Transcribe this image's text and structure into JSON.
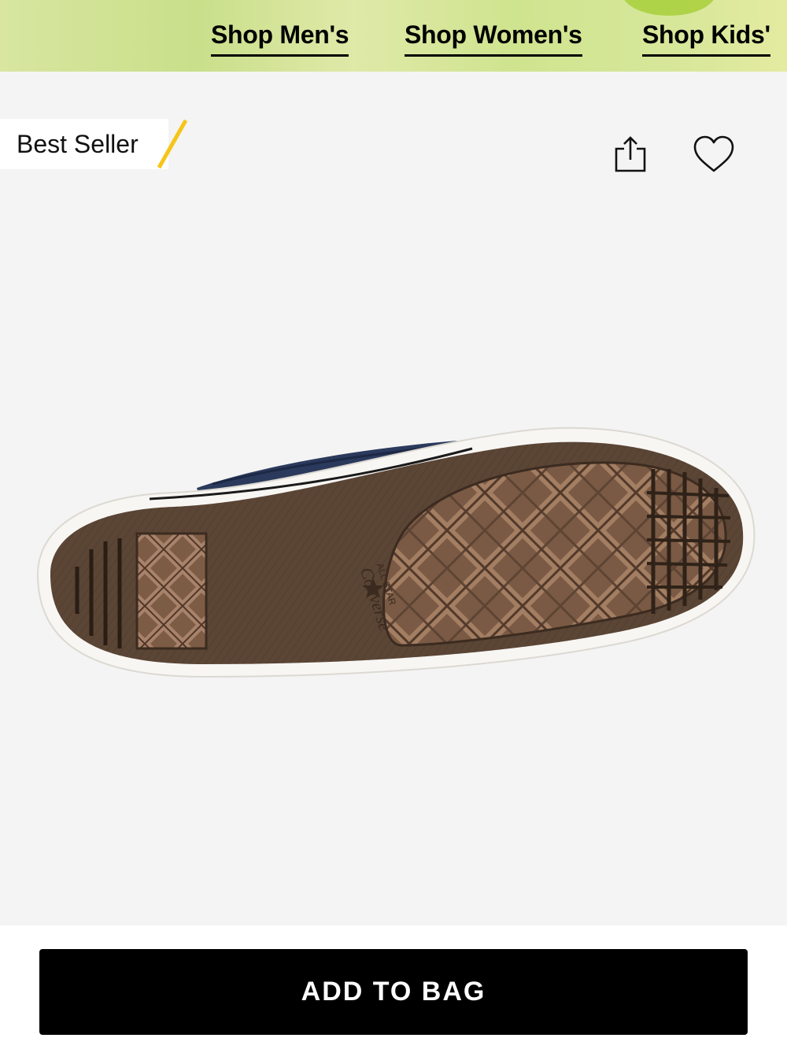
{
  "nav": {
    "links": [
      {
        "label": "Shop Men's"
      },
      {
        "label": "Shop Women's"
      },
      {
        "label": "Shop Kids'"
      }
    ]
  },
  "product": {
    "badge": "Best Seller",
    "badge_accent_color": "#f5c518",
    "image_subject": "shoe-outsole",
    "icons": {
      "share": "share-icon",
      "favorite": "heart-icon"
    },
    "sole_print": {
      "brand": "Converse",
      "line": "ALL STAR"
    }
  },
  "actions": {
    "add_to_bag": "ADD TO BAG"
  },
  "colors": {
    "background": "#f4f4f4",
    "button": "#000000",
    "button_text": "#ffffff",
    "promo_strip": "#d6e79a"
  }
}
